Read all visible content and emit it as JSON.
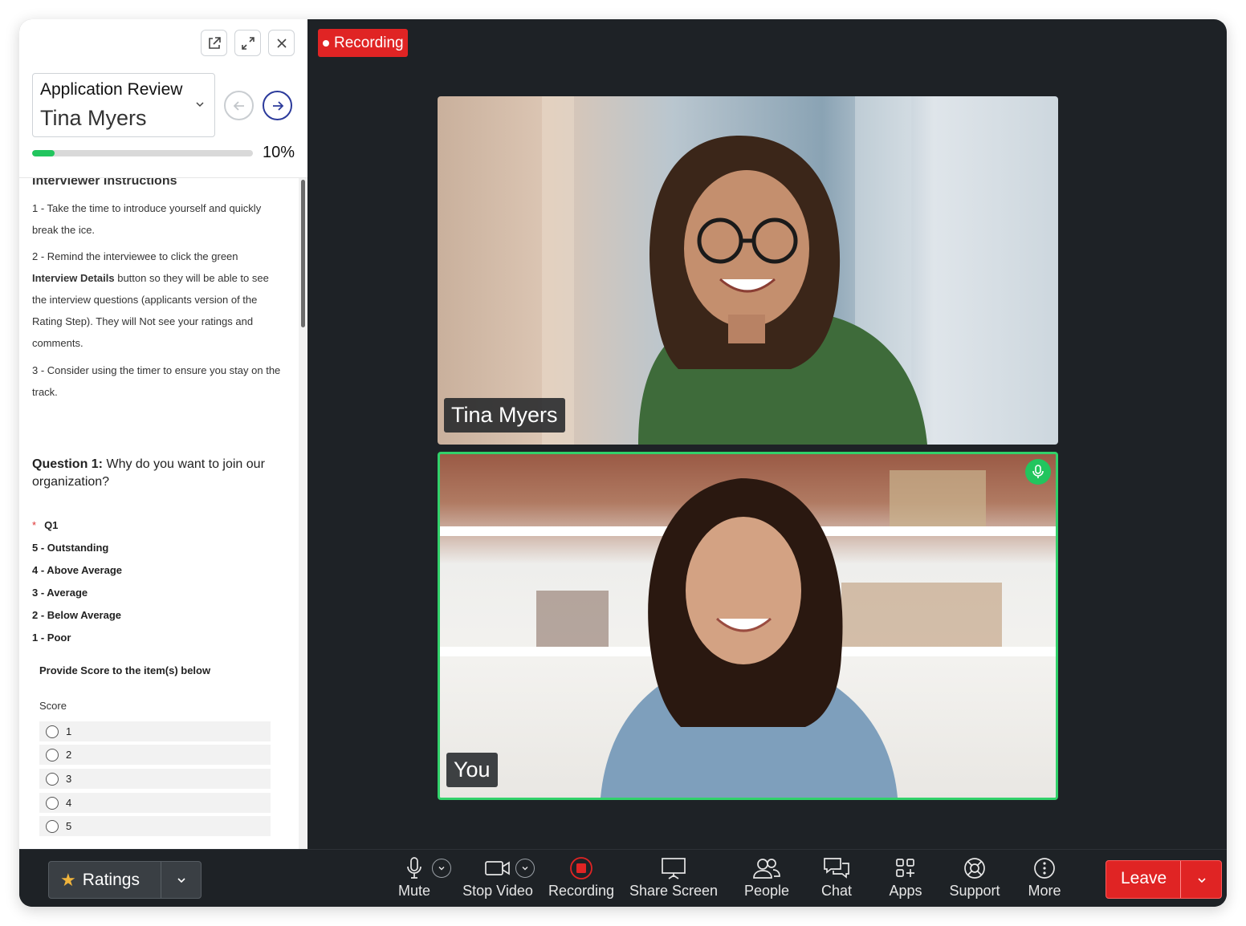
{
  "panel": {
    "header": {
      "app_title": "Application Review",
      "applicant_name": "Tina Myers",
      "progress_percent": 10,
      "progress_label": "10%"
    },
    "instructions": {
      "title": "Interviewer Instructions",
      "item1": "1 - Take the time to introduce yourself and quickly break the ice.",
      "item2_prefix": "2 - Remind the interviewee to click the green ",
      "item2_bold": "Interview Details",
      "item2_suffix": " button so they will be able to see the interview questions (applicants version of the Rating Step). They will Not see your ratings and comments.",
      "item3": "3 - Consider using the timer to ensure you stay on the track."
    },
    "question": {
      "label": "Question 1:",
      "text": " Why do you want to join our organization?",
      "required_mark": "*",
      "code": "Q1",
      "scale": [
        "5 - Outstanding",
        "4 - Above Average",
        "3 - Average",
        "2 - Below Average",
        "1 - Poor"
      ],
      "provide_text": "Provide Score to the item(s) below",
      "score_label": "Score",
      "options": [
        "1",
        "2",
        "3",
        "4",
        "5"
      ]
    }
  },
  "video": {
    "recording_badge": "Recording",
    "top_tile_name": "Tina Myers",
    "bottom_tile_name": "You"
  },
  "toolbar": {
    "ratings_label": "Ratings",
    "mute": "Mute",
    "stop_video": "Stop Video",
    "recording": "Recording",
    "share_screen": "Share Screen",
    "people": "People",
    "chat": "Chat",
    "apps": "Apps",
    "support": "Support",
    "more": "More",
    "leave": "Leave"
  },
  "colors": {
    "accent_green": "#22c55e",
    "record_red": "#e02424",
    "nav_blue": "#2b3a9b",
    "toolbar_bg": "#1e2226"
  }
}
